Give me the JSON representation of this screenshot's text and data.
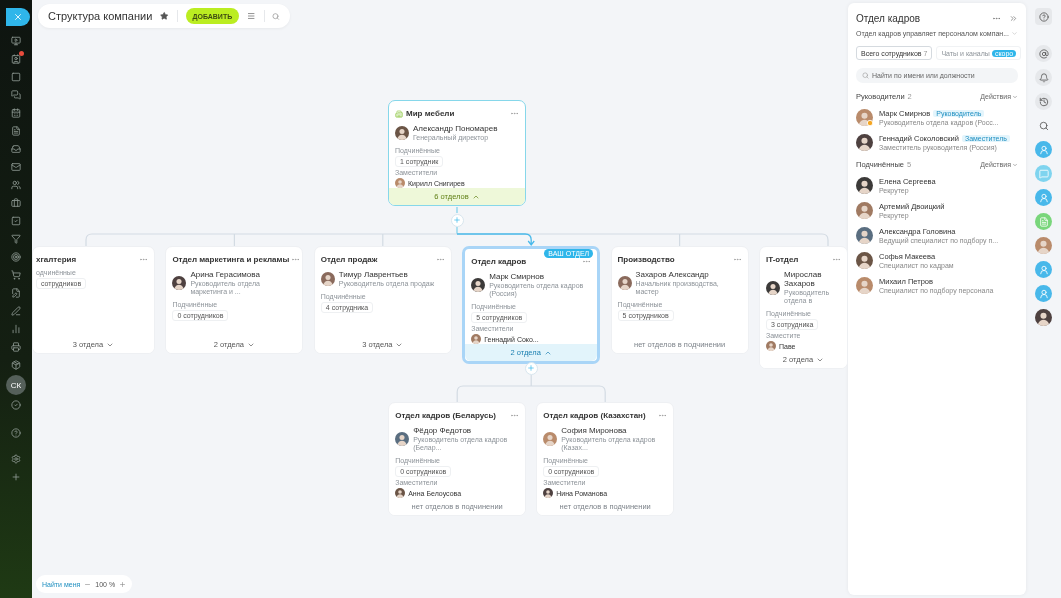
{
  "sidebar": {
    "user_initials": "СК",
    "unread": true
  },
  "header": {
    "title": "Структура компании",
    "favorite": true,
    "add_button": "ДОБАВИТЬ"
  },
  "chart": {
    "title": "Мир мебели",
    "kind": "root",
    "head": {
      "name": "Александр Пономарев",
      "role": "Генеральный директор"
    },
    "subordinates": {
      "label": "Подчинённые",
      "count": "1 сотрудник"
    },
    "deputy": {
      "label": "Заместители",
      "name": "Кирилл Снигирев"
    },
    "footer": {
      "kind": "toggle",
      "text": "6 отделов",
      "expanded": true
    },
    "children": [
      {
        "title": "хгалтерия",
        "kind": "plain",
        "subordinates": {
          "label": "одчинённые",
          "count": "сотрудников"
        },
        "footer": {
          "kind": "toggle",
          "text": "3 отдела",
          "expanded": false
        }
      },
      {
        "title": "Отдел маркетинга и рекламы",
        "kind": "plain",
        "head": {
          "name": "Арина Герасимова",
          "role": "Руководитель отдела маркетинга и ..."
        },
        "subordinates": {
          "label": "Подчинённые",
          "count": "0 сотрудников"
        },
        "footer": {
          "kind": "toggle",
          "text": "2 отдела",
          "expanded": false
        }
      },
      {
        "title": "Отдел продаж",
        "kind": "plain",
        "head": {
          "name": "Тимур Лаврентьев",
          "role": "Руководитель отдела продаж"
        },
        "subordinates": {
          "label": "Подчинённые",
          "count": "4 сотрудника"
        },
        "footer": {
          "kind": "toggle",
          "text": "3 отдела",
          "expanded": false
        }
      },
      {
        "title": "Отдел кадров",
        "kind": "mine",
        "badge": "ВАШ ОТДЕЛ",
        "head": {
          "name": "Марк Смирнов",
          "role": "Руководитель отдела кадров (Россия)"
        },
        "subordinates": {
          "label": "Подчинённые",
          "count": "5 сотрудников"
        },
        "deputy": {
          "label": "Заместители",
          "name": "Геннадий Соко..."
        },
        "footer": {
          "kind": "toggle",
          "text": "2 отдела",
          "expanded": true
        },
        "children": [
          {
            "title": "Отдел кадров (Беларусь)",
            "kind": "plain",
            "head": {
              "name": "Фёдор Федотов",
              "role": "Руководитель отдела кадров (Белар..."
            },
            "subordinates": {
              "label": "Подчинённые",
              "count": "0 сотрудников"
            },
            "deputy": {
              "label": "Заместители",
              "name": "Анна Белоусова"
            },
            "footer": {
              "kind": "empty",
              "text": "нет отделов в подчинении"
            }
          },
          {
            "title": "Отдел кадров (Казахстан)",
            "kind": "plain",
            "head": {
              "name": "София Миронова",
              "role": "Руководитель отдела кадров (Казах..."
            },
            "subordinates": {
              "label": "Подчинённые",
              "count": "0 сотрудников"
            },
            "deputy": {
              "label": "Заместители",
              "name": "Нина Романова"
            },
            "footer": {
              "kind": "empty",
              "text": "нет отделов в подчинении"
            }
          }
        ]
      },
      {
        "title": "Производство",
        "kind": "plain",
        "head": {
          "name": "Захаров Александр",
          "role": "Начальник производства, мастер"
        },
        "subordinates": {
          "label": "Подчинённые",
          "count": "5 сотрудников"
        },
        "footer": {
          "kind": "empty",
          "text": "нет отделов в подчинении"
        }
      },
      {
        "title": "IT-отдел",
        "kind": "plain",
        "head": {
          "name": "Мирослав Захаров",
          "role": "Руководитель отдела в"
        },
        "subordinates": {
          "label": "Подчинённые",
          "count": "3 сотрудника"
        },
        "deputy": {
          "label": "Заместите",
          "name": "Паве"
        },
        "footer": {
          "kind": "toggle",
          "text": "2 отдела",
          "expanded": false
        }
      }
    ]
  },
  "zoom": {
    "find_me": "Найти меня",
    "zoom_text": "100 %"
  },
  "panel": {
    "title": "Отдел кадров",
    "description": "Отдел кадров управляет персоналом компан...",
    "tabs": [
      {
        "label": "Всего сотрудников",
        "count": "7",
        "selected": true
      },
      {
        "label": "Чаты и каналы",
        "badge": "скоро",
        "selected": false
      }
    ],
    "search": {
      "placeholder": "Найти по имени или должности"
    },
    "sections": [
      {
        "title": "Руководители",
        "count": "2",
        "action": "Действия",
        "people": [
          {
            "name": "Марк Смирнов",
            "tag": "Руководитель",
            "role": "Руководитель отдела кадров (Росс...",
            "busy": true
          },
          {
            "name": "Геннадий Соколовский",
            "tag": "Заместитель",
            "role": "Заместитель руководителя (Россия)",
            "busy": false
          }
        ]
      },
      {
        "title": "Подчинённые",
        "count": "5",
        "action": "Действия",
        "people": [
          {
            "name": "Елена Сергеева",
            "role": "Рекрутер",
            "busy": false
          },
          {
            "name": "Артемий Двоицкий",
            "role": "Рекрутер",
            "busy": false
          },
          {
            "name": "Александра Головина",
            "role": "Ведущий специалист по подбору п...",
            "busy": false
          },
          {
            "name": "Софья Макеева",
            "role": "Специалист по кадрам",
            "busy": false
          },
          {
            "name": "Михаил Петров",
            "role": "Специалист по подбору персонала",
            "busy": false
          }
        ]
      }
    ]
  }
}
